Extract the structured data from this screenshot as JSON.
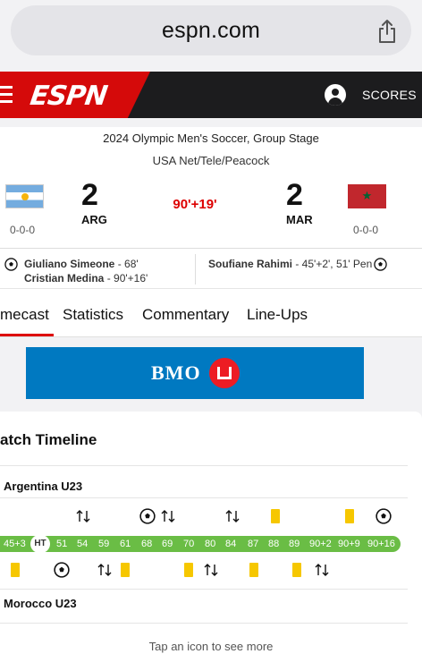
{
  "browser": {
    "url": "espn.com"
  },
  "header": {
    "logo_text": "ESPN",
    "scores_label": "SCORES",
    "brand_color": "#d50a0a"
  },
  "match": {
    "competition": "2024 Olympic Men's Soccer, Group Stage",
    "broadcast": "USA Net/Tele/Peacock",
    "clock": "90'+19'",
    "home": {
      "abbr": "ARG",
      "score": "2",
      "record": "0-0-0",
      "scorers": [
        "Giuliano Simeone",
        " - 68'",
        "Cristian Medina",
        " - 90'+16'"
      ]
    },
    "away": {
      "abbr": "MAR",
      "score": "2",
      "record": "0-0-0",
      "scorers": [
        "Soufiane Rahimi",
        " - 45'+2', 51' Pen"
      ]
    }
  },
  "tabs": [
    "mecast",
    "Statistics",
    "Commentary",
    "Line-Ups"
  ],
  "ad": {
    "text": "BMO"
  },
  "timeline": {
    "title": "atch Timeline",
    "home_team": "Argentina U23",
    "away_team": "Morocco U23",
    "minutes": [
      "45+3",
      "HT",
      "51",
      "54",
      "59",
      "61",
      "68",
      "69",
      "70",
      "80",
      "84",
      "87",
      "88",
      "89",
      "90+2",
      "90+9",
      "90+16"
    ],
    "hint": "Tap an icon to see more",
    "home_events": [
      "substitution",
      "goal",
      "substitution",
      "substitution",
      "yellow-card",
      "yellow-card",
      "goal"
    ],
    "away_events": [
      "yellow-card",
      "goal",
      "substitution",
      "yellow-card",
      "yellow-card",
      "substitution",
      "yellow-card",
      "yellow-card",
      "substitution"
    ]
  }
}
